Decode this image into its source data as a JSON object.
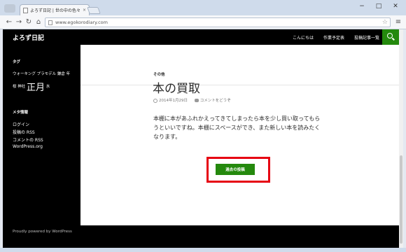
{
  "browser": {
    "tab_title": "よろず日記 | 世の中の色々な",
    "url": "www.egokorodiary.com",
    "window_controls": [
      "−",
      "□",
      "✕"
    ]
  },
  "site": {
    "title": "よろず日記",
    "nav": [
      "こんにちは",
      "作業予定表",
      "投稿記事一覧"
    ]
  },
  "sidebar": {
    "tags_title": "タグ",
    "tags_line1": "ウォーキング プラモデル 鎌倉 年",
    "tags_line2_pre": "桜 神社",
    "tags_big": "正月",
    "tags_line2_post": "水",
    "meta_title": "メタ情報",
    "meta_links": [
      "ログイン",
      "投稿の RSS",
      "コメントの RSS",
      "WordPress.org"
    ],
    "powered": "Proudly powered by WordPress"
  },
  "post": {
    "category": "その他",
    "title": "本の買取",
    "date": "2014年1月29日",
    "comment": "コメントをどうぞ",
    "body": "本棚に本があふれかえってきてしまったら本を少し買い取ってもらうといいですね。本棚にスペースができ、また新しい本を読みたくなります。",
    "older_button": "過去の投稿"
  },
  "colors": {
    "accent": "#24890d",
    "highlight": "#e60012",
    "sidebar_bg": "#000000"
  }
}
